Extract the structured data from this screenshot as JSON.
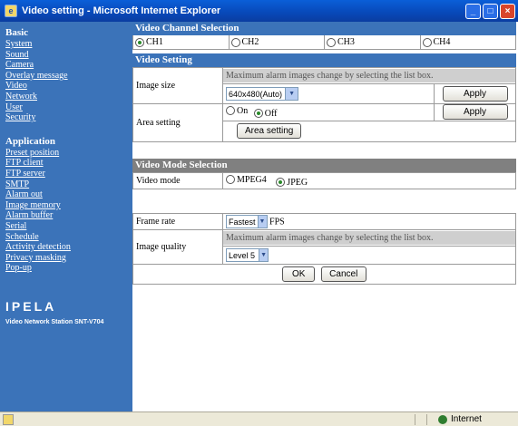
{
  "window": {
    "title": "Video setting - Microsoft Internet Explorer",
    "icon": "ie-icon",
    "buttons": [
      "minimize",
      "maximize",
      "close"
    ]
  },
  "sidebar": {
    "basic_heading": "Basic",
    "basic_items": [
      "System",
      "Sound",
      "Camera",
      "Overlay message",
      "Video",
      "Network",
      "User",
      "Security"
    ],
    "application_heading": "Application",
    "application_items": [
      "Preset position",
      "FTP client",
      "FTP server",
      "SMTP",
      "Alarm out",
      "Image memory",
      "Alarm buffer",
      "Serial",
      "Schedule",
      "Activity detection",
      "Privacy masking",
      "Pop-up"
    ],
    "logo": "IPELA",
    "model": "Video Network Station SNT-V704",
    "bg_color": "#3b73b9"
  },
  "channel": {
    "heading": "Video Channel Selection",
    "options": [
      "CH1",
      "CH2",
      "CH3",
      "CH4"
    ],
    "selected": "CH1"
  },
  "video_setting": {
    "heading": "Video Setting",
    "image_size": {
      "label": "Image size",
      "note": "Maximum alarm images change by selecting the list box.",
      "value": "640x480(Auto)",
      "apply": "Apply"
    },
    "area_setting": {
      "label": "Area setting",
      "options": [
        "On",
        "Off"
      ],
      "selected": "Off",
      "apply": "Apply",
      "button": "Area setting"
    }
  },
  "video_mode": {
    "heading": "Video Mode Selection",
    "label": "Video mode",
    "options": [
      "MPEG4",
      "JPEG"
    ],
    "selected": "JPEG"
  },
  "jpeg": {
    "frame_rate": {
      "label": "Frame rate",
      "value": "Fastest",
      "unit": "FPS"
    },
    "image_quality": {
      "label": "Image quality",
      "note": "Maximum alarm images change by selecting the list box.",
      "value": "Level 5"
    },
    "ok": "OK",
    "cancel": "Cancel"
  },
  "status": {
    "zone": "Internet"
  }
}
